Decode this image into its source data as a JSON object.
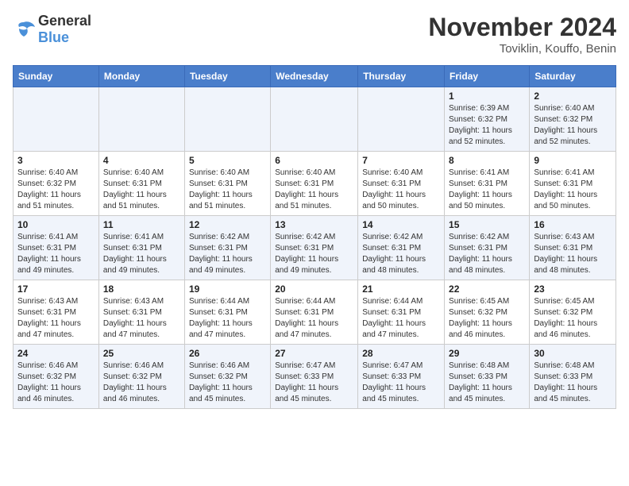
{
  "logo": {
    "general": "General",
    "blue": "Blue"
  },
  "title": "November 2024",
  "location": "Toviklin, Kouffo, Benin",
  "weekdays": [
    "Sunday",
    "Monday",
    "Tuesday",
    "Wednesday",
    "Thursday",
    "Friday",
    "Saturday"
  ],
  "weeks": [
    [
      {
        "day": "",
        "info": ""
      },
      {
        "day": "",
        "info": ""
      },
      {
        "day": "",
        "info": ""
      },
      {
        "day": "",
        "info": ""
      },
      {
        "day": "",
        "info": ""
      },
      {
        "day": "1",
        "info": "Sunrise: 6:39 AM\nSunset: 6:32 PM\nDaylight: 11 hours and 52 minutes."
      },
      {
        "day": "2",
        "info": "Sunrise: 6:40 AM\nSunset: 6:32 PM\nDaylight: 11 hours and 52 minutes."
      }
    ],
    [
      {
        "day": "3",
        "info": "Sunrise: 6:40 AM\nSunset: 6:32 PM\nDaylight: 11 hours and 51 minutes."
      },
      {
        "day": "4",
        "info": "Sunrise: 6:40 AM\nSunset: 6:31 PM\nDaylight: 11 hours and 51 minutes."
      },
      {
        "day": "5",
        "info": "Sunrise: 6:40 AM\nSunset: 6:31 PM\nDaylight: 11 hours and 51 minutes."
      },
      {
        "day": "6",
        "info": "Sunrise: 6:40 AM\nSunset: 6:31 PM\nDaylight: 11 hours and 51 minutes."
      },
      {
        "day": "7",
        "info": "Sunrise: 6:40 AM\nSunset: 6:31 PM\nDaylight: 11 hours and 50 minutes."
      },
      {
        "day": "8",
        "info": "Sunrise: 6:41 AM\nSunset: 6:31 PM\nDaylight: 11 hours and 50 minutes."
      },
      {
        "day": "9",
        "info": "Sunrise: 6:41 AM\nSunset: 6:31 PM\nDaylight: 11 hours and 50 minutes."
      }
    ],
    [
      {
        "day": "10",
        "info": "Sunrise: 6:41 AM\nSunset: 6:31 PM\nDaylight: 11 hours and 49 minutes."
      },
      {
        "day": "11",
        "info": "Sunrise: 6:41 AM\nSunset: 6:31 PM\nDaylight: 11 hours and 49 minutes."
      },
      {
        "day": "12",
        "info": "Sunrise: 6:42 AM\nSunset: 6:31 PM\nDaylight: 11 hours and 49 minutes."
      },
      {
        "day": "13",
        "info": "Sunrise: 6:42 AM\nSunset: 6:31 PM\nDaylight: 11 hours and 49 minutes."
      },
      {
        "day": "14",
        "info": "Sunrise: 6:42 AM\nSunset: 6:31 PM\nDaylight: 11 hours and 48 minutes."
      },
      {
        "day": "15",
        "info": "Sunrise: 6:42 AM\nSunset: 6:31 PM\nDaylight: 11 hours and 48 minutes."
      },
      {
        "day": "16",
        "info": "Sunrise: 6:43 AM\nSunset: 6:31 PM\nDaylight: 11 hours and 48 minutes."
      }
    ],
    [
      {
        "day": "17",
        "info": "Sunrise: 6:43 AM\nSunset: 6:31 PM\nDaylight: 11 hours and 47 minutes."
      },
      {
        "day": "18",
        "info": "Sunrise: 6:43 AM\nSunset: 6:31 PM\nDaylight: 11 hours and 47 minutes."
      },
      {
        "day": "19",
        "info": "Sunrise: 6:44 AM\nSunset: 6:31 PM\nDaylight: 11 hours and 47 minutes."
      },
      {
        "day": "20",
        "info": "Sunrise: 6:44 AM\nSunset: 6:31 PM\nDaylight: 11 hours and 47 minutes."
      },
      {
        "day": "21",
        "info": "Sunrise: 6:44 AM\nSunset: 6:31 PM\nDaylight: 11 hours and 47 minutes."
      },
      {
        "day": "22",
        "info": "Sunrise: 6:45 AM\nSunset: 6:32 PM\nDaylight: 11 hours and 46 minutes."
      },
      {
        "day": "23",
        "info": "Sunrise: 6:45 AM\nSunset: 6:32 PM\nDaylight: 11 hours and 46 minutes."
      }
    ],
    [
      {
        "day": "24",
        "info": "Sunrise: 6:46 AM\nSunset: 6:32 PM\nDaylight: 11 hours and 46 minutes."
      },
      {
        "day": "25",
        "info": "Sunrise: 6:46 AM\nSunset: 6:32 PM\nDaylight: 11 hours and 46 minutes."
      },
      {
        "day": "26",
        "info": "Sunrise: 6:46 AM\nSunset: 6:32 PM\nDaylight: 11 hours and 45 minutes."
      },
      {
        "day": "27",
        "info": "Sunrise: 6:47 AM\nSunset: 6:33 PM\nDaylight: 11 hours and 45 minutes."
      },
      {
        "day": "28",
        "info": "Sunrise: 6:47 AM\nSunset: 6:33 PM\nDaylight: 11 hours and 45 minutes."
      },
      {
        "day": "29",
        "info": "Sunrise: 6:48 AM\nSunset: 6:33 PM\nDaylight: 11 hours and 45 minutes."
      },
      {
        "day": "30",
        "info": "Sunrise: 6:48 AM\nSunset: 6:33 PM\nDaylight: 11 hours and 45 minutes."
      }
    ]
  ]
}
